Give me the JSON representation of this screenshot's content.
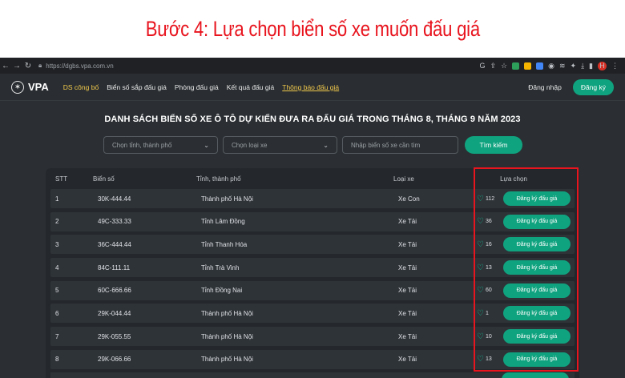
{
  "caption": "Bước 4: Lựa chọn biển số xe muốn đấu giá",
  "browser": {
    "url": "https://dgbs.vpa.com.vn",
    "profile_initial": "H"
  },
  "site": {
    "logo_text": "VPA",
    "menu": [
      "DS công bố",
      "Biển số sắp đấu giá",
      "Phòng đấu giá",
      "Kết quả đấu giá",
      "Thông báo đấu giá"
    ],
    "login": "Đăng nhập",
    "register": "Đăng ký"
  },
  "heading": "DANH SÁCH BIỂN SỐ XE Ô TÔ DỰ KIẾN ĐƯA RA ĐẤU GIÁ TRONG THÁNG 8, THÁNG 9 NĂM 2023",
  "filters": {
    "province_placeholder": "Chọn tỉnh, thành phố",
    "type_placeholder": "Chọn loại xe",
    "search_placeholder": "Nhập biển số xe cần tìm",
    "search_button": "Tìm kiếm"
  },
  "table": {
    "headers": [
      "STT",
      "Biển số",
      "Tỉnh, thành phố",
      "Loại xe",
      "Lựa chọn"
    ],
    "action_label": "Đăng ký đấu giá",
    "rows": [
      {
        "stt": "1",
        "plate": "30K-444.44",
        "city": "Thành phố Hà Nội",
        "type": "Xe Con",
        "likes": "112"
      },
      {
        "stt": "2",
        "plate": "49C-333.33",
        "city": "Tỉnh Lâm Đồng",
        "type": "Xe Tải",
        "likes": "36"
      },
      {
        "stt": "3",
        "plate": "36C-444.44",
        "city": "Tỉnh Thanh Hóa",
        "type": "Xe Tải",
        "likes": "16"
      },
      {
        "stt": "4",
        "plate": "84C-111.11",
        "city": "Tỉnh Trà Vinh",
        "type": "Xe Tải",
        "likes": "13"
      },
      {
        "stt": "5",
        "plate": "60C-666.66",
        "city": "Tỉnh Đồng Nai",
        "type": "Xe Tải",
        "likes": "60"
      },
      {
        "stt": "6",
        "plate": "29K-044.44",
        "city": "Thành phố Hà Nội",
        "type": "Xe Tải",
        "likes": "1"
      },
      {
        "stt": "7",
        "plate": "29K-055.55",
        "city": "Thành phố Hà Nội",
        "type": "Xe Tải",
        "likes": "10"
      },
      {
        "stt": "8",
        "plate": "29K-066.66",
        "city": "Thành phố Hà Nội",
        "type": "Xe Tải",
        "likes": "13"
      }
    ]
  },
  "colors": {
    "accent": "#10a37f",
    "highlight": "#e8141e",
    "menu_active": "#f2c94c"
  }
}
